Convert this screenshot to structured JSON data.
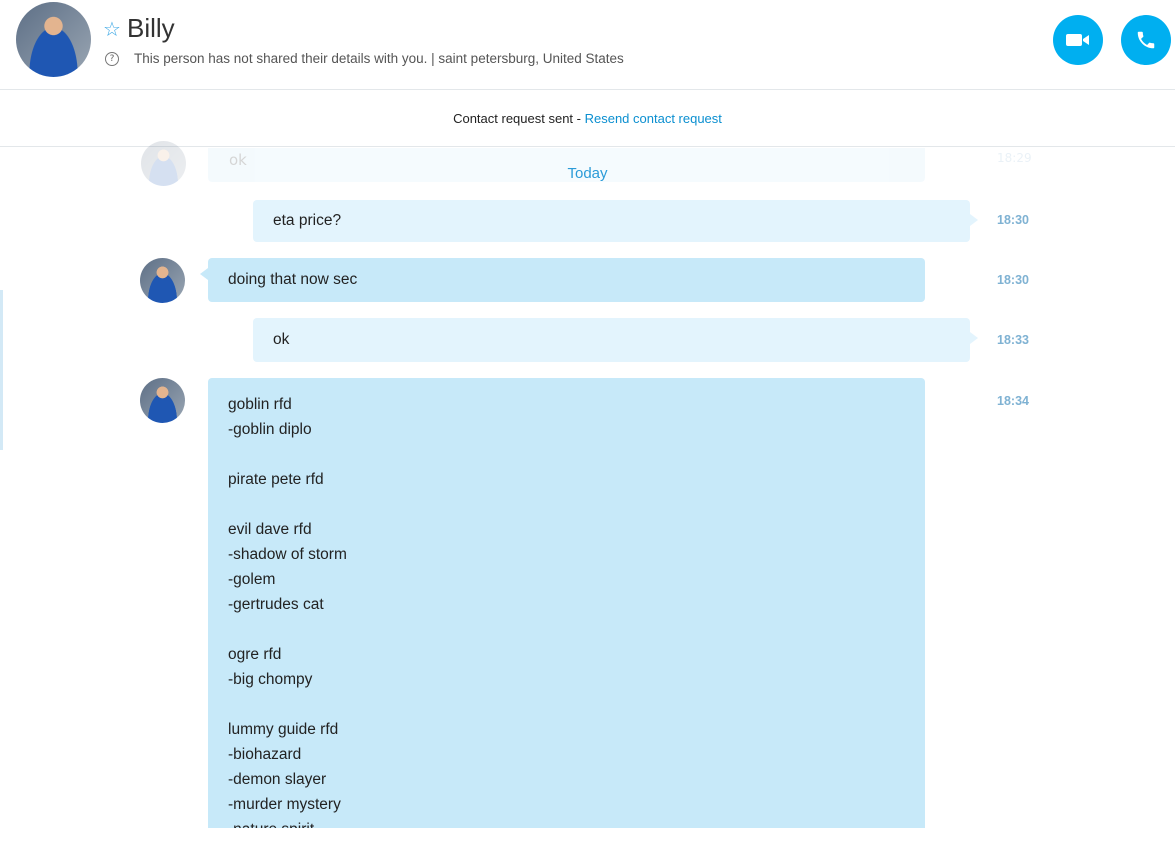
{
  "header": {
    "name": "Billy",
    "subtitle": "This person has not shared their details with you.  |  saint petersburg, United States",
    "help_glyph": "?",
    "star_glyph": "☆"
  },
  "notice": {
    "text": "Contact request sent - ",
    "link": "Resend contact request"
  },
  "conversation": {
    "faded_message": {
      "text": "ok",
      "time": "18:29"
    },
    "date_divider": "Today",
    "messages": [
      {
        "direction": "out",
        "text": "eta price?",
        "time": "18:30"
      },
      {
        "direction": "in",
        "text": "doing that now sec",
        "time": "18:30"
      },
      {
        "direction": "out",
        "text": "ok",
        "time": "18:33"
      },
      {
        "direction": "in",
        "time": "18:34",
        "lines": [
          "goblin rfd",
          "-goblin diplo",
          "",
          "pirate pete rfd",
          "",
          "evil dave rfd",
          "-shadow of storm",
          "-golem",
          "-gertrudes cat",
          "",
          "ogre rfd",
          "-big chompy",
          "",
          "lummy guide rfd",
          "-biohazard",
          "-demon slayer",
          "-murder mystery",
          "-nature spirit"
        ]
      }
    ]
  },
  "colors": {
    "accent": "#00aff0",
    "incoming_bubble": "#c7e9f9",
    "outgoing_bubble": "#e3f4fd",
    "link": "#0b8fd0"
  },
  "icons": {
    "video": "video-camera-icon",
    "audio": "phone-icon",
    "favorite": "star-icon",
    "help": "help-circle-icon"
  }
}
